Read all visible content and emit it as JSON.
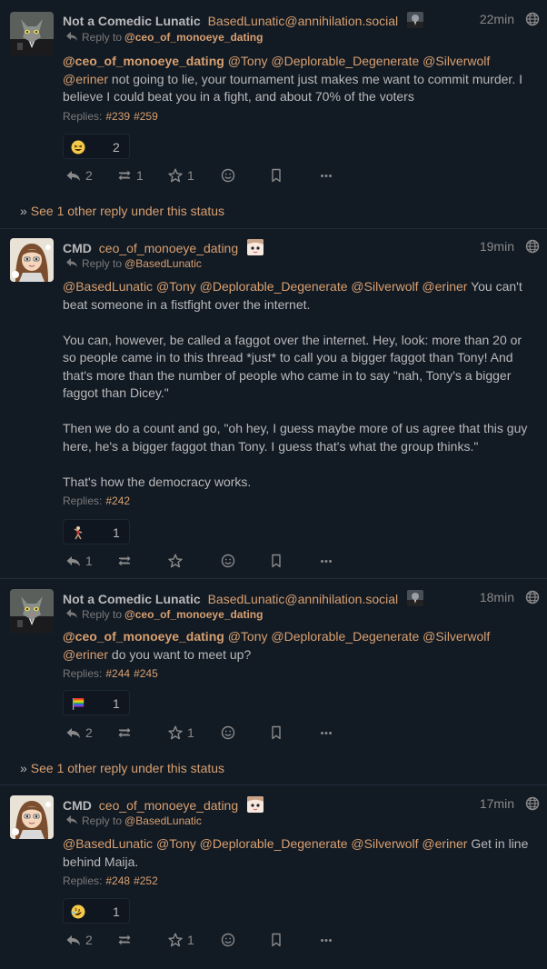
{
  "icons": {
    "globe": "globe-icon",
    "reply": "reply-icon",
    "repeat": "repeat-icon",
    "favorite": "star-icon",
    "react": "smiley-icon",
    "bookmark": "bookmark-icon",
    "more": "ellipsis-icon",
    "expand": "chevron-right-icon"
  },
  "colors": {
    "background": "#121a24",
    "accent": "#d8a070",
    "text": "#b9b9ba",
    "muted": "#8a8a8a"
  },
  "statuses": [
    {
      "author_name": "Not a Comedic Lunatic",
      "author_acct": "BasedLunatic@annihilation.social",
      "time": "22min",
      "reply_label": "Reply to",
      "reply_to": "@ceo_of_monoeye_dating",
      "mentions": [
        "@ceo_of_monoeye_dating",
        "@Tony",
        "@Deplorable_Degenerate",
        "@Silverwolf",
        "@eriner"
      ],
      "content": " not going to lie, your tournament just makes me want to commit murder. I believe I could beat you in a fight, and about 70% of the voters",
      "replies_label": "Replies:",
      "replies": [
        "#239",
        "#259"
      ],
      "reaction": {
        "emoji": "laughing-face",
        "count": "2"
      },
      "actions": {
        "reply_count": "2",
        "repeat_count": "1",
        "favorite_count": "1"
      },
      "see_more": "See 1 other reply under this status"
    },
    {
      "author_name": "CMD",
      "author_acct": "ceo_of_monoeye_dating",
      "time": "19min",
      "reply_label": "Reply to",
      "reply_to": "@BasedLunatic",
      "mentions": [
        "@BasedLunatic",
        "@Tony",
        "@Deplorable_Degenerate",
        "@Silverwolf",
        "@eriner"
      ],
      "content_p1": " You can't beat someone in a fistfight over the internet.",
      "content_p2": "You can, however, be called a faggot over the internet. Hey, look: more than 20 or so people came in to this thread *just* to call you a bigger faggot than Tony! And that's more than the number of people who came in to say \"nah, Tony's a bigger faggot than Dicey.\"",
      "content_p3": "Then we do a count and go, \"oh hey, I guess maybe more of us agree that this guy here, he's a bigger faggot than Tony. I guess that's what the group thinks.\"",
      "content_p4": "That's how the democracy works.",
      "replies_label": "Replies:",
      "replies": [
        "#242"
      ],
      "reaction": {
        "emoji": "dancing-figure",
        "count": "1"
      },
      "actions": {
        "reply_count": "1"
      }
    },
    {
      "author_name": "Not a Comedic Lunatic",
      "author_acct": "BasedLunatic@annihilation.social",
      "time": "18min",
      "reply_label": "Reply to",
      "reply_to": "@ceo_of_monoeye_dating",
      "mentions": [
        "@ceo_of_monoeye_dating",
        "@Tony",
        "@Deplorable_Degenerate",
        "@Silverwolf",
        "@eriner"
      ],
      "content": " do you want to meet up?",
      "replies_label": "Replies:",
      "replies": [
        "#244",
        "#245"
      ],
      "reaction": {
        "emoji": "rainbow-flag",
        "count": "1"
      },
      "actions": {
        "reply_count": "2",
        "favorite_count": "1"
      },
      "see_more": "See 1 other reply under this status"
    },
    {
      "author_name": "CMD",
      "author_acct": "ceo_of_monoeye_dating",
      "time": "17min",
      "reply_label": "Reply to",
      "reply_to": "@BasedLunatic",
      "mentions": [
        "@BasedLunatic",
        "@Tony",
        "@Deplorable_Degenerate",
        "@Silverwolf",
        "@eriner"
      ],
      "content": " Get in line behind Maija.",
      "replies_label": "Replies:",
      "replies": [
        "#248",
        "#252"
      ],
      "reaction": {
        "emoji": "rolling-laughing-face",
        "count": "1"
      },
      "actions": {
        "reply_count": "2",
        "favorite_count": "1"
      }
    }
  ]
}
